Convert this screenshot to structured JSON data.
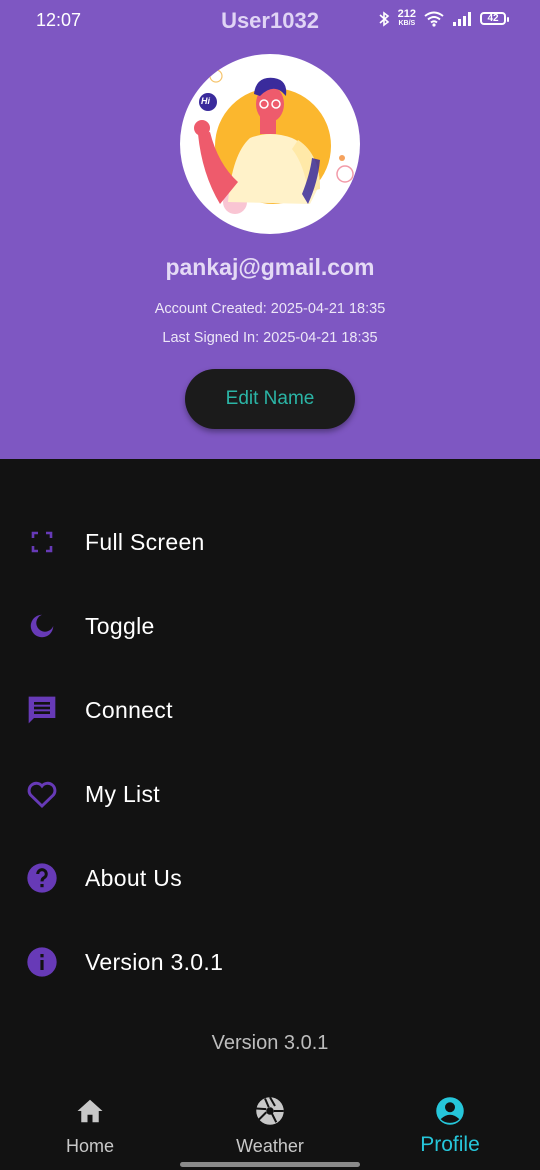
{
  "status": {
    "time": "12:07",
    "net_speed_value": "212",
    "net_speed_unit": "KB/S",
    "battery": "42"
  },
  "app": {
    "title": "User1032"
  },
  "avatar": {
    "greeting": "Hi"
  },
  "profile": {
    "email": "pankaj@gmail.com",
    "account_created": "Account Created: 2025-04-21 18:35",
    "last_signed_in": "Last Signed In: 2025-04-21 18:35",
    "edit_button": "Edit Name"
  },
  "menu": {
    "items": [
      {
        "label": "Full Screen",
        "icon": "fullscreen-icon"
      },
      {
        "label": "Toggle",
        "icon": "moon-icon"
      },
      {
        "label": "Connect",
        "icon": "chat-icon"
      },
      {
        "label": "My List",
        "icon": "heart-icon"
      },
      {
        "label": "About Us",
        "icon": "help-icon"
      },
      {
        "label": "Version 3.0.1",
        "icon": "info-icon"
      }
    ]
  },
  "footer": {
    "version": "Version 3.0.1"
  },
  "nav": {
    "items": [
      {
        "label": "Home",
        "icon": "home-icon"
      },
      {
        "label": "Weather",
        "icon": "camera-aperture-icon"
      },
      {
        "label": "Profile",
        "icon": "account-circle-icon",
        "active": true
      }
    ]
  },
  "colors": {
    "header": "#7e57c2",
    "accent": "#673ab7",
    "teal": "#26c6da",
    "background": "#121212"
  }
}
